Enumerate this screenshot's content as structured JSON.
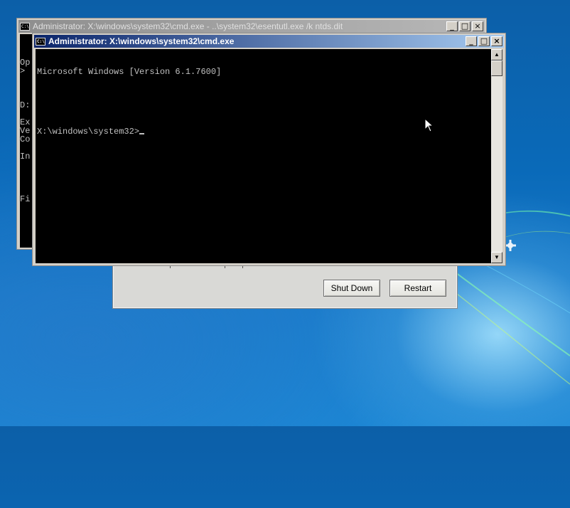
{
  "background_windows": {
    "cmd_esentutl": {
      "title": "Administrator: X:\\windows\\system32\\cmd.exe - ..\\system32\\esentutl.exe  /k ntds.dit",
      "visible_lines": [
        "Op",
        ">",
        "",
        "",
        "",
        "D:",
        "",
        "Ex",
        "Ve",
        "Co",
        "",
        "In",
        "",
        "",
        "",
        "",
        "Fi"
      ]
    }
  },
  "shutdown_dialog": {
    "shut_down_label": "Shut Down",
    "restart_label": "Restart"
  },
  "cmd_window": {
    "title": "Administrator: X:\\windows\\system32\\cmd.exe",
    "lines": [
      "Microsoft Windows [Version 6.1.7600]",
      "",
      "X:\\windows\\system32>"
    ]
  },
  "window_buttons": {
    "minimize": "_",
    "maximize": "□",
    "close": "×"
  },
  "colors": {
    "console_bg": "#000000",
    "console_fg": "#c0c0c0",
    "active_title": "#0a246a",
    "inactive_title": "#8e8e8e",
    "desktop": "#0a6ab9"
  }
}
